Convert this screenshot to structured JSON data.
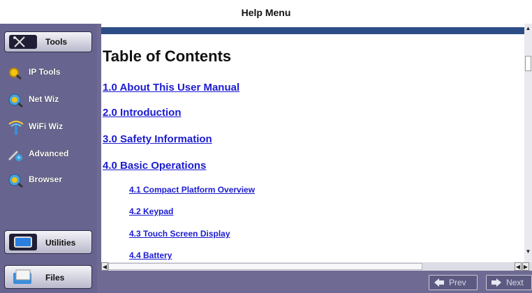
{
  "window": {
    "title": "Help Menu"
  },
  "sidebar": {
    "tools_label": "Tools",
    "items": [
      {
        "label": "IP Tools",
        "icon": "magnifier-icon"
      },
      {
        "label": "Net Wiz",
        "icon": "globe-magnifier-icon"
      },
      {
        "label": "WiFi Wiz",
        "icon": "wifi-antenna-icon"
      },
      {
        "label": "Advanced",
        "icon": "advanced-tools-icon"
      },
      {
        "label": "Browser",
        "icon": "globe-magnifier-icon"
      }
    ],
    "utilities_label": "Utilities",
    "files_label": "Files"
  },
  "content": {
    "heading": "Table of Contents",
    "toc": [
      {
        "text": "1.0 About This User Manual",
        "level": 1
      },
      {
        "text": "2.0 Introduction",
        "level": 1
      },
      {
        "text": "3.0 Safety Information",
        "level": 1
      },
      {
        "text": "4.0 Basic Operations",
        "level": 1
      },
      {
        "text": "4.1 Compact Platform Overview",
        "level": 2
      },
      {
        "text": "4.2 Keypad",
        "level": 2
      },
      {
        "text": "4.3 Touch Screen Display",
        "level": 2
      },
      {
        "text": "4.4 Battery",
        "level": 2
      }
    ]
  },
  "footer": {
    "prev_label": "Prev",
    "next_label": "Next"
  },
  "colors": {
    "sidebar_bg": "#67658f",
    "content_header_bar": "#2d4d86",
    "link": "#1b1bd1"
  }
}
